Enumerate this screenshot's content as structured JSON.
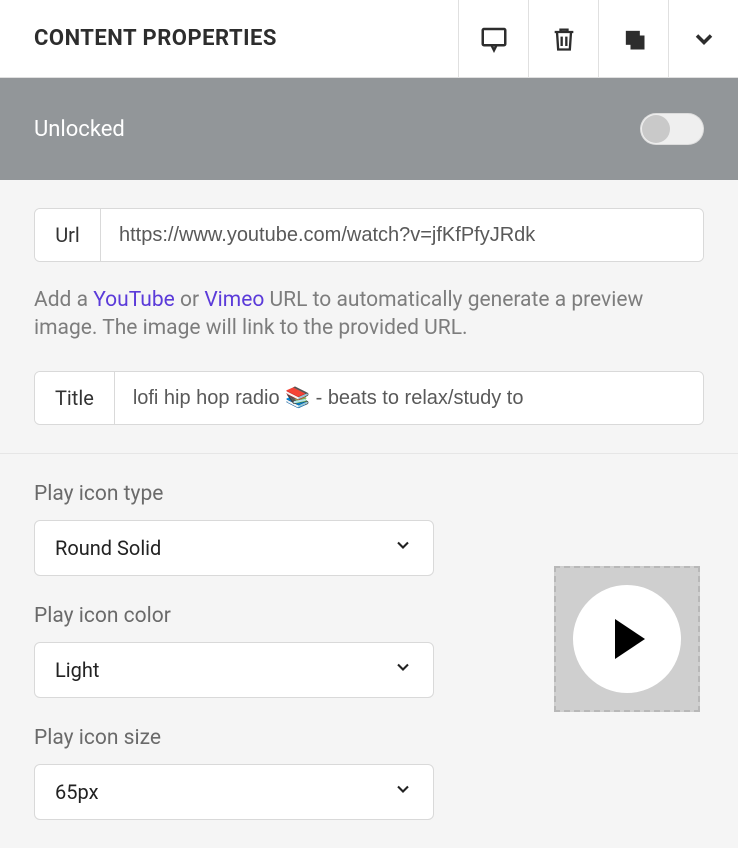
{
  "header": {
    "title": "CONTENT PROPERTIES"
  },
  "lockbar": {
    "label": "Unlocked",
    "locked": false
  },
  "url_field": {
    "label": "Url",
    "value": "https://www.youtube.com/watch?v=jfKfPfyJRdk"
  },
  "helper": {
    "prefix": "Add a ",
    "youtube": "YouTube",
    "middle": " or ",
    "vimeo": "Vimeo",
    "suffix": " URL to automatically generate a preview image. The image will link to the provided URL."
  },
  "title_field": {
    "label": "Title",
    "value": "lofi hip hop radio 📚 - beats to relax/study to"
  },
  "controls": {
    "play_icon_type": {
      "label": "Play icon type",
      "value": "Round Solid"
    },
    "play_icon_color": {
      "label": "Play icon color",
      "value": "Light"
    },
    "play_icon_size": {
      "label": "Play icon size",
      "value": "65px"
    }
  }
}
